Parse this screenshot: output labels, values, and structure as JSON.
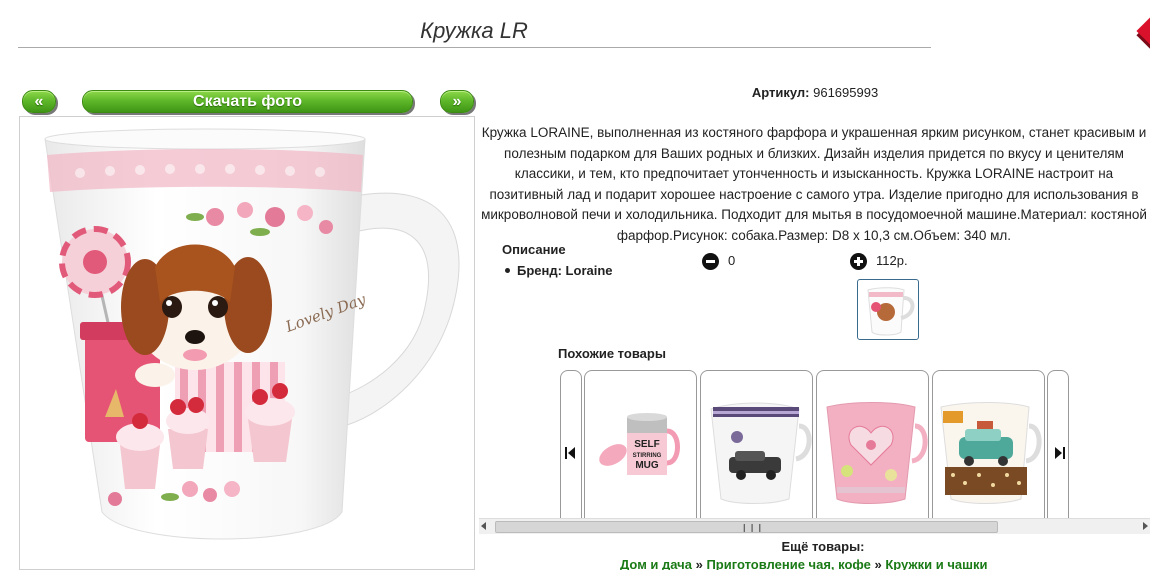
{
  "page_title": "Кружка LR",
  "buttons": {
    "prev": "«",
    "download": "Скачать фото",
    "next": "»"
  },
  "product": {
    "article_label": "Артикул:",
    "article_value": "961695993",
    "description": "Кружка LORAINE, выполненная из костяного фарфора и украшенная ярким рисунком, станет красивым и полезным подарком для Ваших родных и близких. Дизайн изделия придется по вкусу и ценителям классики, и тем, кто предпочитает утонченность и изысканность. Кружка LORAINE настроит на позитивный лад и подарит хорошее настроение с самого утра. Изделие пригодно для использования в микроволновой печи и холодильника. Подходит для мытья в посудомоечной машине.Материал: костяной фарфор.Рисунок: собака.Размер: D8 x 10,3 см.Объем: 340 мл.",
    "desc_heading": "Описание",
    "brand": "Бренд: Loraine"
  },
  "votes": {
    "down": "0",
    "up": "112р."
  },
  "similar": {
    "heading": "Похожие товары",
    "mug_text": "SELF STIRRING MUG"
  },
  "more": {
    "heading": "Ещё товары:",
    "crumbs": [
      "Дом и дача",
      "Приготовление чая, кофе",
      "Кружки и чашки"
    ],
    "separator": "»"
  },
  "colors": {
    "accent_green": "#5fb82a",
    "link_green": "#1a7a16",
    "mug_pink": "#e89aa8"
  }
}
